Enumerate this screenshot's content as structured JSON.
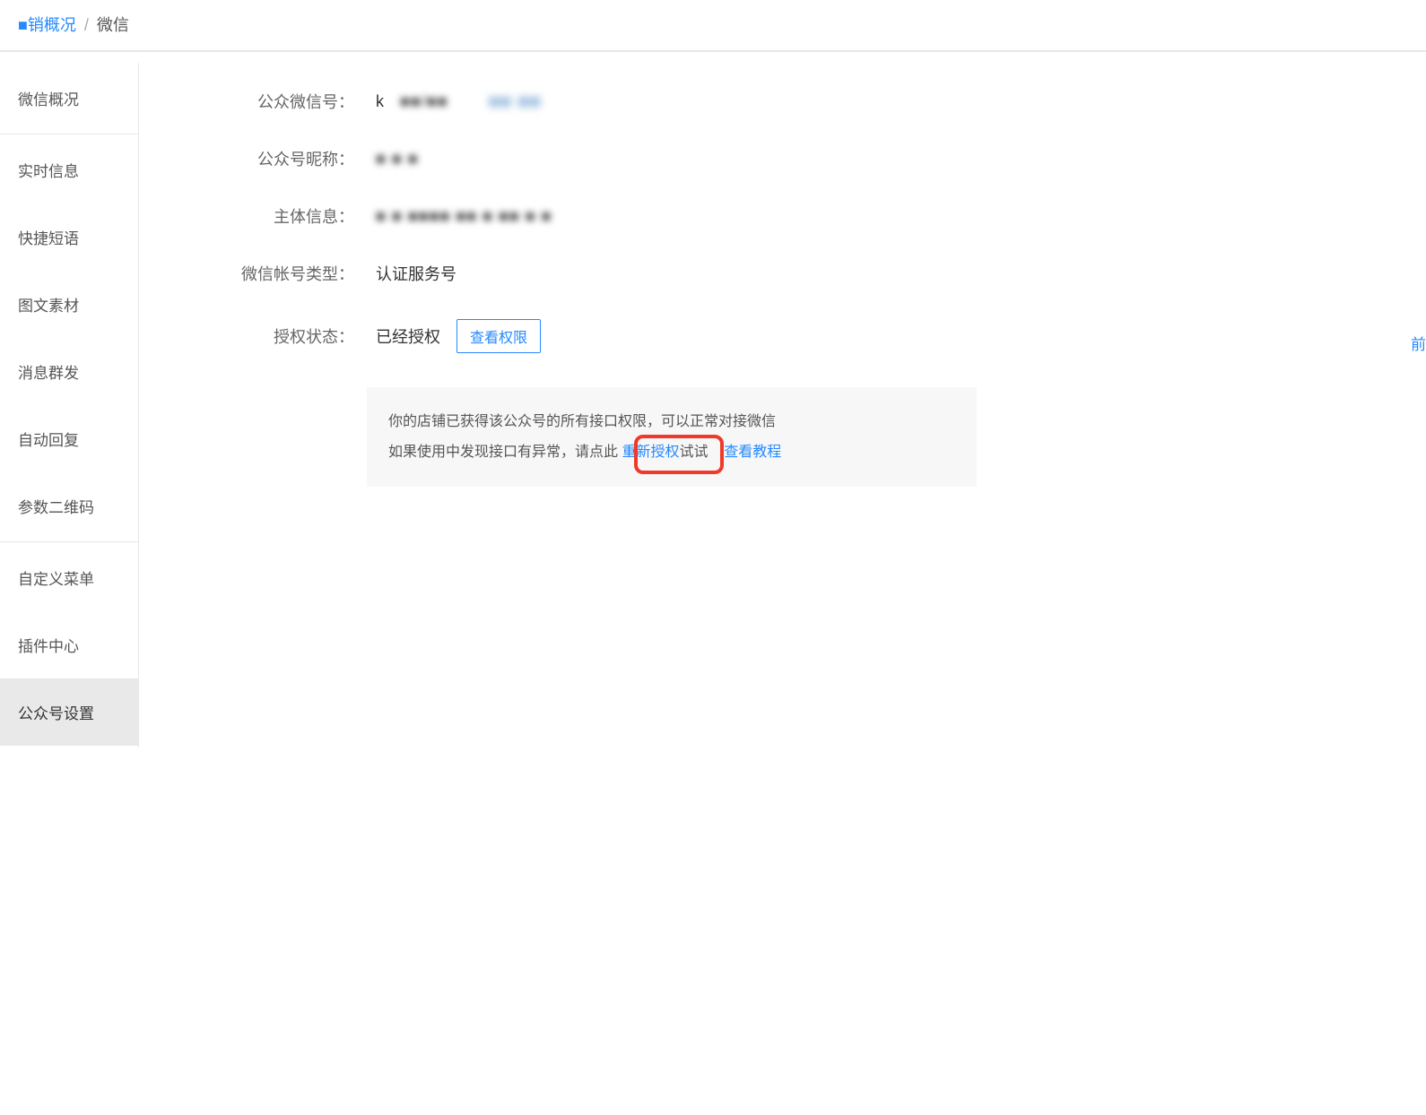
{
  "breadcrumb": {
    "parent": "■销概况",
    "current": "微信"
  },
  "sidebar": {
    "group1": [
      {
        "label": "微信概况"
      }
    ],
    "group2": [
      {
        "label": "实时信息"
      },
      {
        "label": "快捷短语"
      },
      {
        "label": "图文素材"
      },
      {
        "label": "消息群发"
      },
      {
        "label": "自动回复"
      },
      {
        "label": "参数二维码"
      }
    ],
    "group3": [
      {
        "label": "自定义菜单"
      },
      {
        "label": "插件中心"
      },
      {
        "label": "公众号设置",
        "active": true
      }
    ]
  },
  "fields": {
    "wechat_id": {
      "label": "公众微信号：",
      "value_prefix": "k",
      "value_blur1": "■■/■■",
      "value_blur2": "■■ ■■"
    },
    "nickname": {
      "label": "公众号昵称：",
      "value_blur": "■  ■ ■"
    },
    "subject": {
      "label": "主体信息：",
      "value_blur": "■ ■ ■■■■ ■■ ■ ■■ ■  ■"
    },
    "acct_type": {
      "label": "微信帐号类型：",
      "value": "认证服务号"
    },
    "auth": {
      "label": "授权状态：",
      "value": "已经授权",
      "button": "查看权限"
    }
  },
  "side_link": "前",
  "notice": {
    "line1": "你的店铺已获得该公众号的所有接口权限，可以正常对接微信",
    "line2_before": "如果使用中发现接口有异常，请点此 ",
    "reauth": "重新授权",
    "line2_after": "试试",
    "tutorial": "查看教程"
  }
}
